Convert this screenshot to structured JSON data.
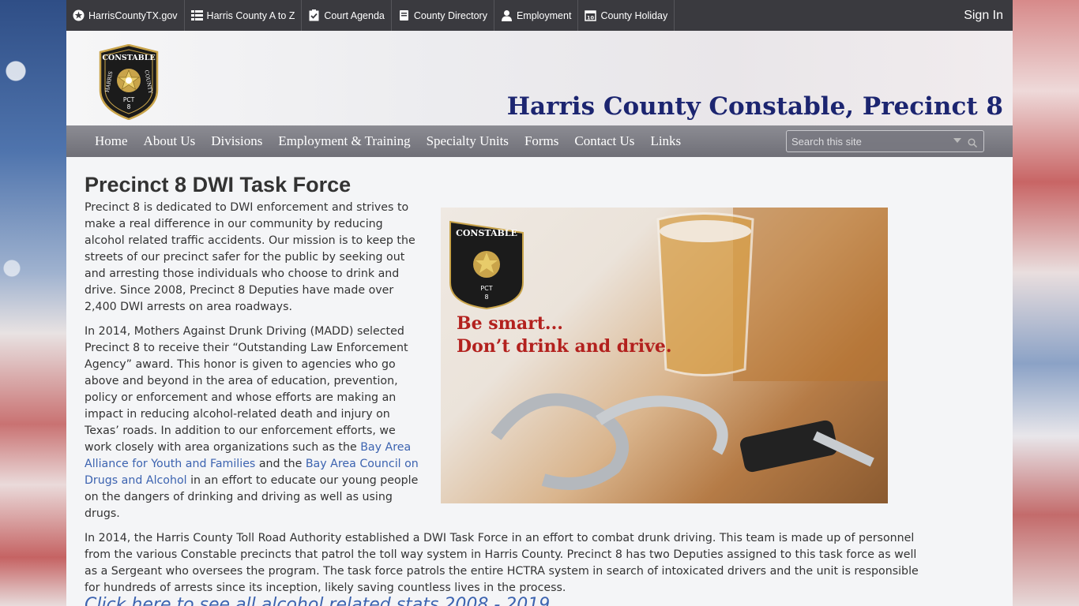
{
  "topbar": {
    "items": [
      {
        "label": "HarrisCountyTX.gov",
        "icon": "star-circle-icon"
      },
      {
        "label": "Harris County A to Z",
        "icon": "list-icon"
      },
      {
        "label": "Court Agenda",
        "icon": "clipboard-check-icon"
      },
      {
        "label": "County Directory",
        "icon": "book-icon"
      },
      {
        "label": "Employment",
        "icon": "user-icon"
      },
      {
        "label": "County Holiday",
        "icon": "calendar-icon"
      }
    ],
    "sign_in": "Sign In"
  },
  "header": {
    "badge": {
      "top": "CONSTABLE",
      "left": "HARRIS",
      "right": "COUNTY",
      "pct": "PCT",
      "num": "8"
    },
    "title": "Harris County Constable, Precinct 8"
  },
  "nav": {
    "items": [
      "Home",
      "About Us",
      "Divisions",
      "Employment & Training",
      "Specialty Units",
      "Forms",
      "Contact Us",
      "Links"
    ],
    "search_placeholder": "Search this site"
  },
  "main": {
    "heading": "Precinct 8 DWI Task Force",
    "p1": "Precinct 8 is dedicated to DWI enforcement and strives to make a real difference in our community by reducing alcohol related traffic accidents.  Our mission is to keep the streets of our precinct safer for the public by seeking out and arresting those individuals who choose to drink and drive.  Since 2008, Precinct 8 Deputies have made over 2,400 DWI arrests on area roadways.",
    "p2_a": "In 2014, Mothers Against Drunk Driving (MADD) selected Precinct 8 to receive their “Outstanding Law Enforcement Agency” award.  This honor is given to agencies who go above and beyond in the area of education, prevention, policy or enforcement and whose efforts are making an impact in reducing alcohol-related death and injury on Texas’ roads.  In addition to our enforcement efforts, we work closely with area organizations such as the ",
    "p2_link1": "Bay Area Alliance for Youth and Families",
    "p2_b": " and the ",
    "p2_link2": "Bay Area Council on Drugs and Alcohol",
    "p2_c": " in an effort to educate our young people on the dangers of drinking and driving as well as using drugs.",
    "p3": "In 2014, the Harris County Toll Road Authority established a DWI Task Force in an effort to combat drunk driving.  This team is made up of personnel from the various Constable precincts that patrol the toll way system in Harris County.  Precinct 8 has two Deputies assigned to this task force as well as a Sergeant who oversees the program.  The task force patrols the entire HCTRA system in search of intoxicated drivers and the unit is responsible for hundreds of arrests since its inception, likely saving countless lives in the process.",
    "photo": {
      "slogan_line1": "Be smart...",
      "slogan_line2": "Don’t drink and drive.",
      "badge_top": "CONSTABLE",
      "badge_pct": "PCT",
      "badge_num": "8"
    },
    "bottom_link": "Click here to see all alcohol related stats 2008 - 2019"
  },
  "colors": {
    "title": "#1c2570",
    "link": "#3c63b0",
    "topbar": "#3a3a3f",
    "slogan": "#b3211e"
  }
}
